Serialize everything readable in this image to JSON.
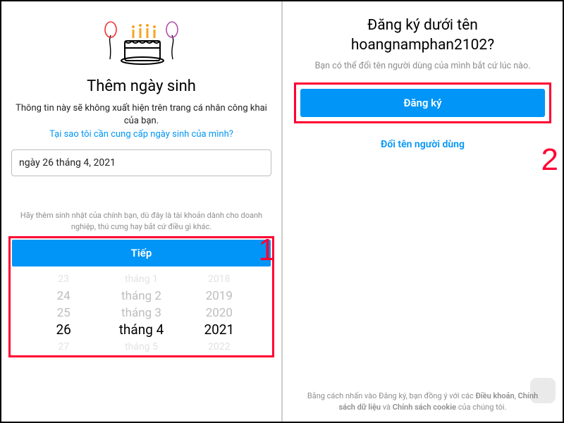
{
  "left": {
    "title": "Thêm ngày sinh",
    "subtitle": "Thông tin này sẽ không xuất hiện trên trang cá nhân công khai của bạn.",
    "why_link": "Tại sao tôi cần cung cấp ngày sinh của mình?",
    "date_value": "ngày 26 tháng 4, 2021",
    "helper": "Hãy thêm sinh nhật của chính bạn, dù đây là tài khoản dành cho doanh nghiệp, thú cưng hay bắt cứ điều gì khác.",
    "next_label": "Tiếp",
    "picker": {
      "day": {
        "r0": "23",
        "r1": "24",
        "r2": "25",
        "sel": "26",
        "r4": "27"
      },
      "month": {
        "r0": "tháng 1",
        "r1": "tháng 2",
        "r2": "tháng 3",
        "sel": "tháng 4",
        "r4": "tháng 5"
      },
      "year": {
        "r0": "2018",
        "r1": "2019",
        "r2": "2020",
        "sel": "2021",
        "r4": "2022"
      }
    },
    "step_number": "1"
  },
  "right": {
    "title_l1": "Đăng ký dưới tên",
    "title_l2": "hoangnamphan2102?",
    "subtitle": "Bạn có thể đổi tên người dùng của mình bắt cứ lúc nào.",
    "signup_label": "Đăng ký",
    "change_username": "Đổi tên người dùng",
    "step_number": "2",
    "terms_prefix": "Bằng cách nhấn vào Đăng ký, bạn đồng ý với các ",
    "terms_1": "Điều khoản",
    "terms_sep1": ", ",
    "terms_2": "Chính sách dữ liệu",
    "terms_sep2": " và ",
    "terms_3": "Chính sách cookie",
    "terms_suffix": " của chúng tôi."
  }
}
